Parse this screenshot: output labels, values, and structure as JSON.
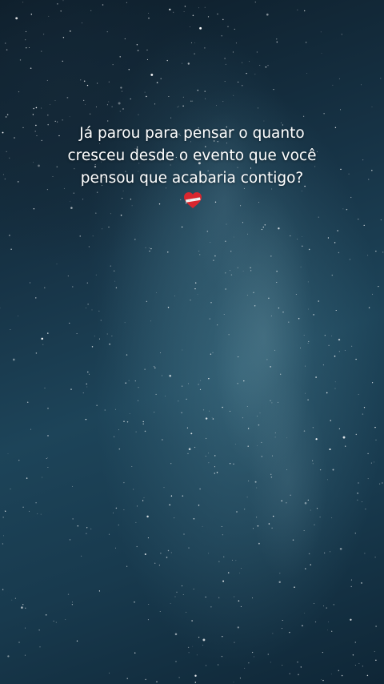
{
  "story": {
    "caption_lines": [
      "Já parou para pensar o quanto",
      "cresceu desde o evento que você",
      "pensou que acabaria contigo?"
    ],
    "emoji": "mending-heart-icon"
  },
  "colors": {
    "sky_dark": "#0b1a26",
    "sky_teal": "#1d4459",
    "text": "#ffffff",
    "heart_red": "#d8262e"
  }
}
